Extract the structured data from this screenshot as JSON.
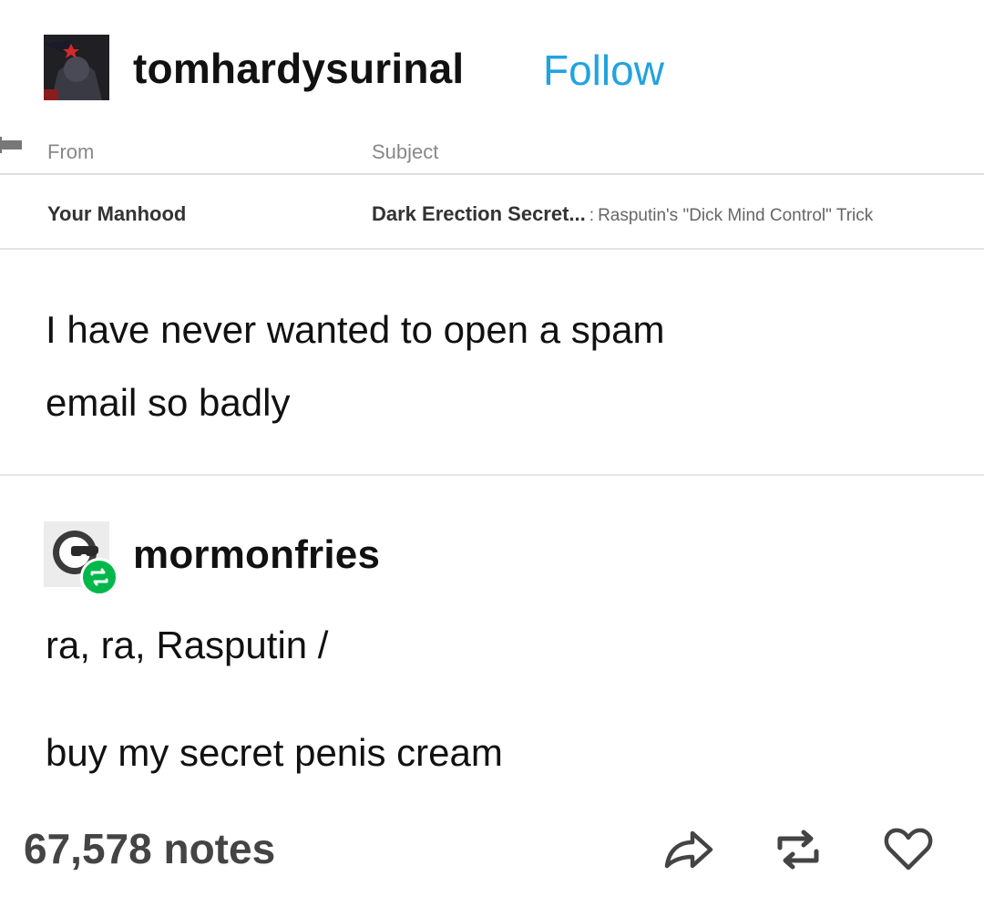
{
  "post": {
    "author": {
      "username": "tomhardysurinal",
      "follow_label": "Follow"
    },
    "email_screenshot": {
      "header_from": "From",
      "header_subject": "Subject",
      "row": {
        "from": "Your Manhood",
        "subject_bold": "Dark Erection Secret...",
        "subject_sep": ":",
        "preview": "Rasputin's \"Dick Mind Control\" Trick"
      }
    },
    "text_line1": "I have never wanted to open a spam",
    "text_line2": "email so badly"
  },
  "reblog": {
    "username": "mormonfries",
    "line1": "ra, ra, Rasputin /",
    "line2": "buy my secret penis cream"
  },
  "footer": {
    "notes": "67,578 notes",
    "actions": [
      "share-icon",
      "reblog-icon",
      "heart-icon"
    ]
  },
  "colors": {
    "accent_link": "#21a3e0",
    "reblog_badge": "#00b84a"
  }
}
